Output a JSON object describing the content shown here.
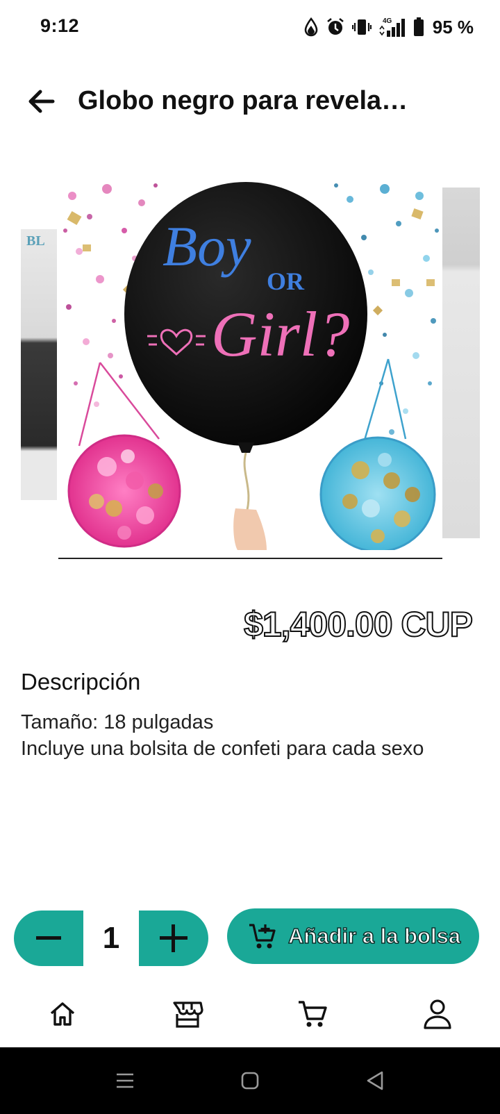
{
  "status_bar": {
    "time": "9:12",
    "battery_percent": "95 %",
    "network": "4G",
    "icons": [
      "data-saver-icon",
      "alarm-icon",
      "vibrate-icon",
      "signal-icon",
      "battery-icon"
    ]
  },
  "app_bar": {
    "title": "Globo negro para revela…",
    "back_icon": "arrow-left-icon"
  },
  "product": {
    "image_texts": {
      "left_thumb_label": "BL",
      "balloon_line_1": "Boy",
      "balloon_line_2": "OR",
      "balloon_line_3": "Girl?"
    },
    "price": "$1,400.00 CUP"
  },
  "description": {
    "heading": "Descripción",
    "line_1": "Tamaño: 18 pulgadas",
    "line_2": "Incluye una bolsita de confeti para cada sexo"
  },
  "cart_controls": {
    "quantity": "1",
    "add_label": "Añadir a la bolsa",
    "accent_color": "#1aa897"
  },
  "bottom_nav": {
    "items": [
      "home-icon",
      "store-icon",
      "cart-icon",
      "profile-icon"
    ]
  },
  "system_nav": {
    "items": [
      "recents-icon",
      "home-circle-icon",
      "back-triangle-icon"
    ]
  }
}
